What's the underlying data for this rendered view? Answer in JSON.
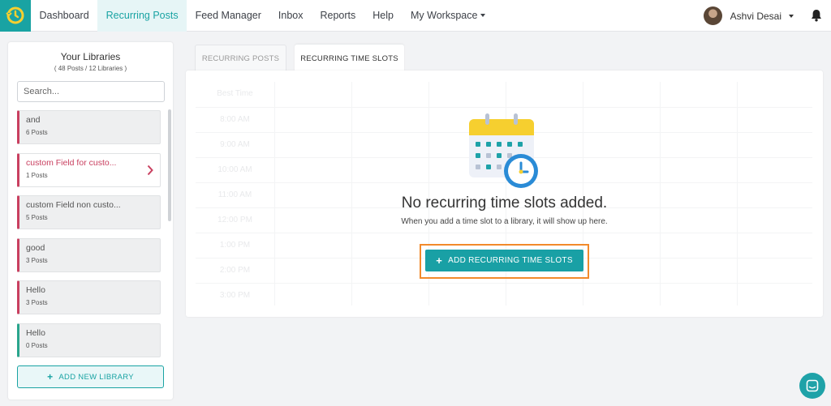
{
  "nav": {
    "items": [
      {
        "label": "Dashboard",
        "active": false
      },
      {
        "label": "Recurring Posts",
        "active": true
      },
      {
        "label": "Feed Manager",
        "active": false
      },
      {
        "label": "Inbox",
        "active": false
      },
      {
        "label": "Reports",
        "active": false
      },
      {
        "label": "Help",
        "active": false
      },
      {
        "label": "My Workspace",
        "active": false
      }
    ],
    "user_name": "Ashvi Desai"
  },
  "sidebar": {
    "title": "Your Libraries",
    "subtitle": "( 48 Posts / 12 Libraries )",
    "search_placeholder": "Search...",
    "libraries": [
      {
        "name": "and",
        "count": "6 Posts"
      },
      {
        "name": "custom Field for custo...",
        "count": "1 Posts"
      },
      {
        "name": "custom Field non custo...",
        "count": "5 Posts"
      },
      {
        "name": "good",
        "count": "3 Posts"
      },
      {
        "name": "Hello",
        "count": "3 Posts"
      },
      {
        "name": "Hello",
        "count": "0 Posts"
      }
    ],
    "add_library_label": "ADD NEW LIBRARY"
  },
  "tabs": {
    "recurring_posts": "RECURRING POSTS",
    "recurring_time_slots": "RECURRING TIME SLOTS"
  },
  "panel": {
    "grid_header": "Best Time",
    "times": [
      "8:00 AM",
      "9:00 AM",
      "10:00 AM",
      "11:00 AM",
      "12:00 PM",
      "1:00 PM",
      "2:00 PM",
      "3:00 PM"
    ],
    "empty_title": "No recurring time slots added.",
    "empty_subtitle": "When you add a time slot to a library, it will show up here.",
    "add_slot_label": "ADD RECURRING TIME SLOTS"
  },
  "colors": {
    "brand": "#19a3a3",
    "library_accent": "#c94060",
    "library_accent_alt": "#2aa58d",
    "highlight": "#f28a2b"
  }
}
